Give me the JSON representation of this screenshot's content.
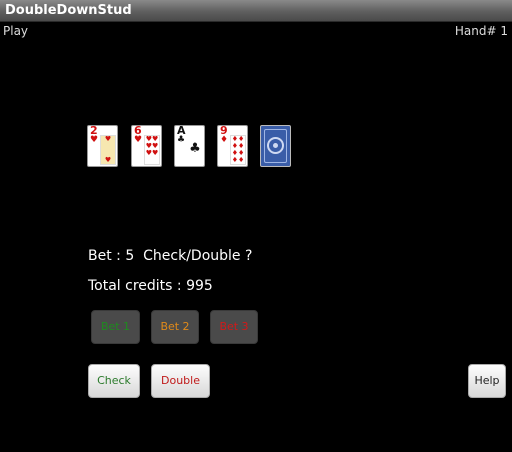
{
  "window": {
    "title": "DoubleDownStud"
  },
  "header": {
    "mode": "Play",
    "hand": "Hand# 1"
  },
  "cards": [
    {
      "rank": "2",
      "suit": "♥",
      "color": "red"
    },
    {
      "rank": "6",
      "suit": "♥",
      "color": "red"
    },
    {
      "rank": "A",
      "suit": "♣",
      "color": "black"
    },
    {
      "rank": "9",
      "suit": "♦",
      "color": "red"
    },
    {
      "face_down": true
    }
  ],
  "status": {
    "bet_text": "Bet : 5  Check/Double ?",
    "credits_text": "Total credits : 995"
  },
  "bet_buttons": [
    {
      "label": "Bet 1",
      "color": "#1f8a1f"
    },
    {
      "label": "Bet 2",
      "color": "#e08a1a"
    },
    {
      "label": "Bet 3",
      "color": "#d01a1a"
    }
  ],
  "actions": {
    "check": {
      "label": "Check",
      "color": "#2a7a2a"
    },
    "double": {
      "label": "Double",
      "color": "#c01a1a"
    },
    "help": {
      "label": "Help",
      "color": "#222222"
    }
  }
}
